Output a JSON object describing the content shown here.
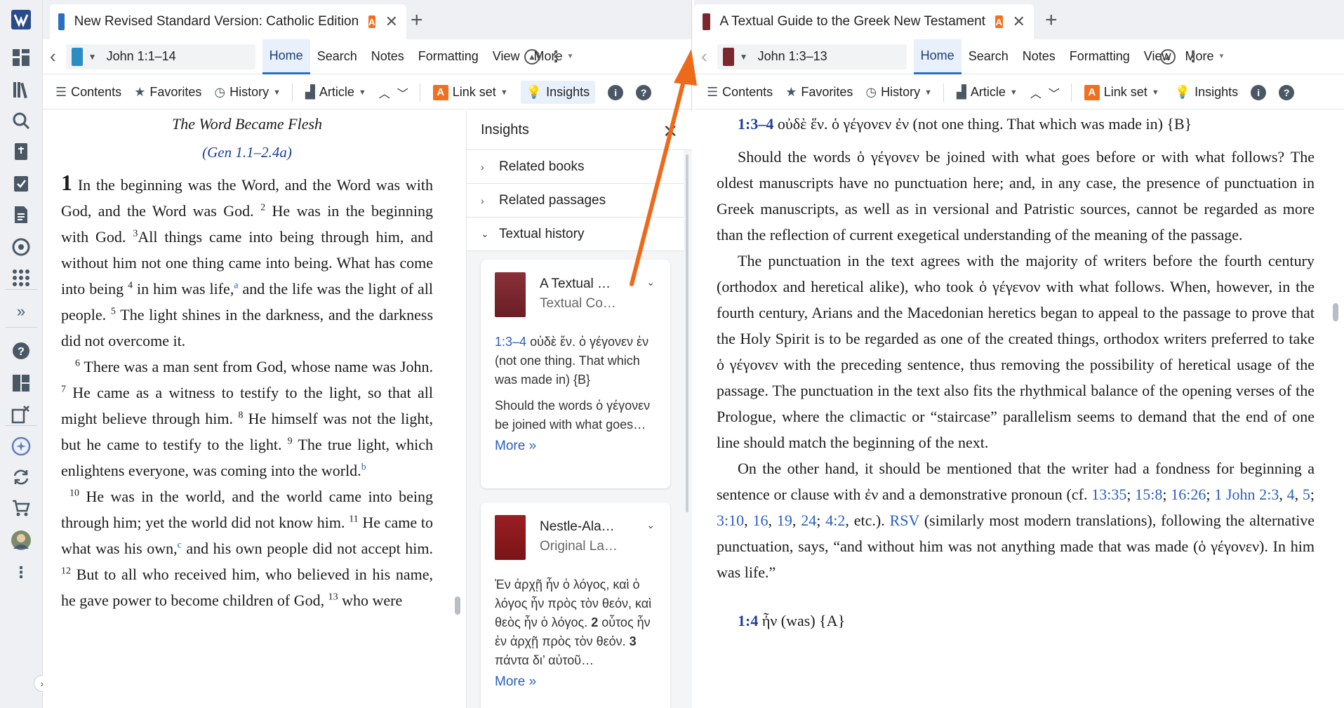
{
  "colors": {
    "accent": "#2a6fc4",
    "link_orange": "#f07020",
    "arrow": "#ee6a1a",
    "book_red": "#7a2730"
  },
  "rail": {
    "icons": [
      "logo-icon",
      "dashboard-icon",
      "library-icon",
      "search-icon",
      "bible-icon",
      "checklist-icon",
      "document-icon",
      "layers-icon",
      "apps-icon",
      "expand-icon",
      "help-icon",
      "layouts-icon",
      "close-panels-icon",
      "ai-icon",
      "sync-icon",
      "cart-icon",
      "avatar"
    ]
  },
  "left": {
    "tab_title": "New Revised Standard Version: Catholic Edition",
    "tab_link": "A",
    "reference": "John 1:1–14",
    "menu": [
      "Home",
      "Search",
      "Notes",
      "Formatting",
      "View",
      "More"
    ],
    "toolbar": {
      "contents": "Contents",
      "favorites": "Favorites",
      "history": "History",
      "article": "Article",
      "link_set_badge": "A",
      "link_set": "Link set",
      "insights": "Insights"
    },
    "heading": "The Word Became Flesh",
    "subheading": "(Gen 1.1–2.4a)",
    "chapter": "1",
    "p1": {
      "v1": "In the beginning was the Word, and the Word was with God, and the Word was God.",
      "n2": "2",
      "v2": "He was in the beginning with God.",
      "n3": "3",
      "v3": "All things came into being through him, and without him not one thing came into being. What has come into being",
      "n4": "4",
      "v4a": "in him was life,",
      "fa": "a",
      "v4b": "and the life was the light of all people.",
      "n5": "5",
      "v5": "The light shines in the darkness, and the darkness did not overcome it."
    },
    "p2": {
      "n6": "6",
      "v6": "There was a man sent from God, whose name was John.",
      "n7": "7",
      "v7": "He came as a witness to testify to the light, so that all might believe through him.",
      "n8": "8",
      "v8": "He himself was not the light, but he came to testify to the light.",
      "n9": "9",
      "v9": "The true light, which enlightens everyone, was coming into the world.",
      "fb": "b"
    },
    "p3": {
      "n10": "10",
      "v10": "He was in the world, and the world came into being through him; yet the world did not know him.",
      "n11": "11",
      "v11a": "He came to what was his own,",
      "fc": "c",
      "v11b": "and his own people did not accept him.",
      "n12": "12",
      "v12": "But to all who received him, who believed in his name, he gave power to become children of God,",
      "n13": "13",
      "v13": "who were"
    }
  },
  "insights": {
    "title": "Insights",
    "sections": [
      "Related books",
      "Related passages",
      "Textual history"
    ],
    "cards": [
      {
        "title": "A Textual …",
        "subtitle": "Textual Co…",
        "ref": "1:3–4",
        "lemma": "οὐδὲ ἕν. ὁ γέγονεν ἐν (not one thing. That which was made in) {B}",
        "body": "Should the words ὁ γέγονεν be joined with what goes…",
        "more": "More »"
      },
      {
        "title": "Nestle-Ala…",
        "subtitle": "Original La…",
        "body_a": "Ἐν ἀρχῇ ἦν ὁ λόγος, καὶ ὁ λόγος ἦν πρὸς τὸν θεόν, καὶ θεὸς ἦν ὁ λόγος.",
        "n2": "2",
        "body_b": "οὗτος ἦν ἐν ἀρχῇ πρὸς τὸν θεόν.",
        "n3": "3",
        "body_c": "πάντα δι’ αὐτοῦ…",
        "more": "More »"
      }
    ]
  },
  "right": {
    "tab_title": "A Textual Guide to the Greek New Testament",
    "tab_link": "A",
    "reference": "John 1:3–13",
    "menu": [
      "Home",
      "Search",
      "Notes",
      "Formatting",
      "View",
      "More"
    ],
    "toolbar": {
      "contents": "Contents",
      "favorites": "Favorites",
      "history": "History",
      "article": "Article",
      "link_set_badge": "A",
      "link_set": "Link set",
      "insights": "Insights"
    },
    "lemma1_ref": "1:3–4",
    "lemma1_text": "οὐδὲ ἕν. ὁ γέγονεν ἐν (not one thing. That which was made in) {B}",
    "para1": "Should the words ὁ γέγονεν be joined with what goes before or with what follows? The oldest manuscripts have no punctuation here; and, in any case, the presence of punctuation in Greek manuscripts, as well as in versional and Patristic sources, cannot be regarded as more than the reflection of current exegetical understanding of the meaning of the passage.",
    "para2": "The punctuation in the text agrees with the majority of writers before the fourth century (orthodox and heretical alike), who took ὁ γέγενον with what follows. When, however, in the fourth century, Arians and the Macedonian heretics began to appeal to the passage to prove that the Holy Spirit is to be regarded as one of the created things, orthodox writers preferred to take ὁ γέγονεν with the preceding sentence, thus removing the possibility of heretical usage of the passage. The punctuation in the text also fits the rhythmical balance of the opening verses of the Prologue, where the climactic or “staircase” parallelism seems to demand that the end of one line should match the beginning of the next.",
    "para3_a": "On the other hand, it should be mentioned that the writer had a fondness for beginning a sentence or clause with ἐν and a demonstrative pronoun (cf.",
    "links": [
      "13:35",
      "15:8",
      "16:26",
      "1 John 2:3",
      "4",
      "5",
      "3:10",
      "16",
      "19",
      "24",
      "4:2"
    ],
    "para3_b": "etc.).",
    "rsv": "RSV",
    "para3_c": "(similarly most modern translations), following the alternative punctuation, says, “and without him was not anything made that was made (ὁ γέγονεν). In him was life.”",
    "lemma2_ref": "1:4",
    "lemma2_text": "ἦν (was) {A}"
  }
}
